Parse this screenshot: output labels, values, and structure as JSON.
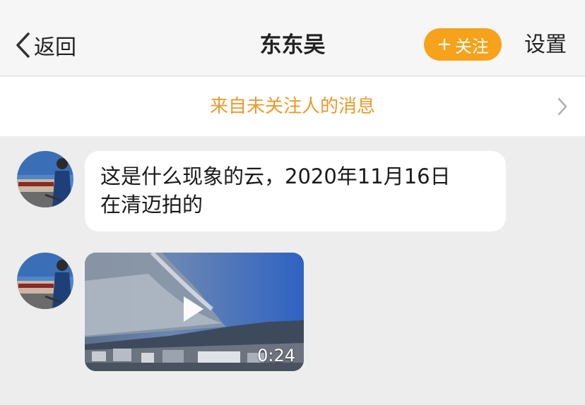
{
  "nav": {
    "back_label": "返回",
    "title": "东东吴",
    "follow_label": "关注",
    "follow_plus": "+",
    "settings_label": "设置"
  },
  "notice": {
    "text": "来自未关注人的消息"
  },
  "messages": [
    {
      "type": "text",
      "line1": "这是什么现象的云，2020年11月16日",
      "line2": "在清迈拍的"
    },
    {
      "type": "video",
      "duration": "0:24"
    }
  ],
  "colors": {
    "accent": "#f7a21b",
    "notice_text": "#e89a2e",
    "background": "#ededed"
  },
  "icons": {
    "back": "chevron-left-icon",
    "notice_arrow": "chevron-right-icon",
    "play": "play-icon"
  }
}
